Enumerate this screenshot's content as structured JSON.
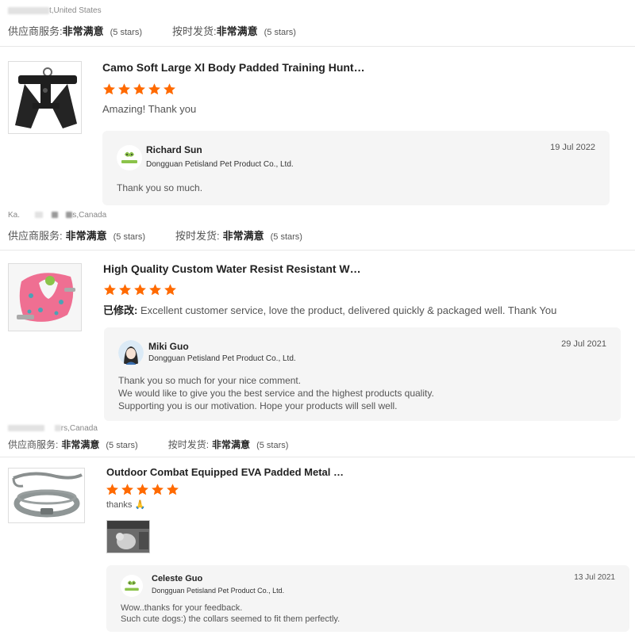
{
  "reviews_top": {
    "location_suffix": "t,United States",
    "supplier_service_label": "供应商服务:",
    "supplier_service_value": "非常满意",
    "supplier_service_stars": "(5 stars)",
    "ontime_label": "按时发货:",
    "ontime_value": "非常满意",
    "ontime_stars": "(5 stars)"
  },
  "reviews": [
    {
      "product_title": "Camo Soft Large Xl Body Padded Training Hunt…",
      "stars": 5,
      "comment": "Amazing! Thank you",
      "reply": {
        "name": "Richard Sun",
        "company": "Dongguan Petisland Pet Product Co., Ltd.",
        "date": "19 Jul 2022",
        "text": "Thank you so much."
      },
      "footer": {
        "location_prefix": "Ka.",
        "location_suffix": "s,Canada",
        "supplier_service_label": "供应商服务:",
        "supplier_service_value": "非常满意",
        "supplier_service_stars": "(5 stars)",
        "ontime_label": "按时发货:",
        "ontime_value": "非常满意",
        "ontime_stars": "(5 stars)"
      }
    },
    {
      "product_title": "High Quality Custom Water Resist Resistant W…",
      "stars": 5,
      "edited_label": "已修改:",
      "comment": "Excellent customer service, love the product, delivered quickly &  packaged well.  Thank You",
      "reply": {
        "name": "Miki Guo",
        "company": "Dongguan Petisland Pet Product Co., Ltd.",
        "date": "29 Jul 2021",
        "text_lines": [
          "Thank you so much for your nice comment.",
          "We would like to give you the best service and the highest products quality.",
          "Supporting you is our motivation. Hope your products will sell well."
        ]
      },
      "footer": {
        "location_suffix": "rs,Canada",
        "supplier_service_label": "供应商服务:",
        "supplier_service_value": "非常满意",
        "supplier_service_stars": "(5 stars)",
        "ontime_label": "按时发货:",
        "ontime_value": "非常满意",
        "ontime_stars": "(5 stars)"
      }
    },
    {
      "product_title": "Outdoor Combat Equipped EVA Padded Metal …",
      "stars": 5,
      "comment": "thanks 🙏",
      "reply": {
        "name": "Celeste Guo",
        "company": "Dongguan Petisland Pet Product Co., Ltd.",
        "date": "13 Jul 2021",
        "text_lines": [
          "Wow..thanks for your feedback.",
          "Such cute dogs:) the collars seemed to fit them perfectly."
        ]
      }
    }
  ],
  "colors": {
    "star": "#ff6a00",
    "reply_bg": "#f5f5f5",
    "logo_green": "#8bc34a"
  },
  "icons": {
    "star": "star-icon",
    "supplier_logo": "petisland-logo-icon",
    "avatar": "user-avatar-icon"
  }
}
